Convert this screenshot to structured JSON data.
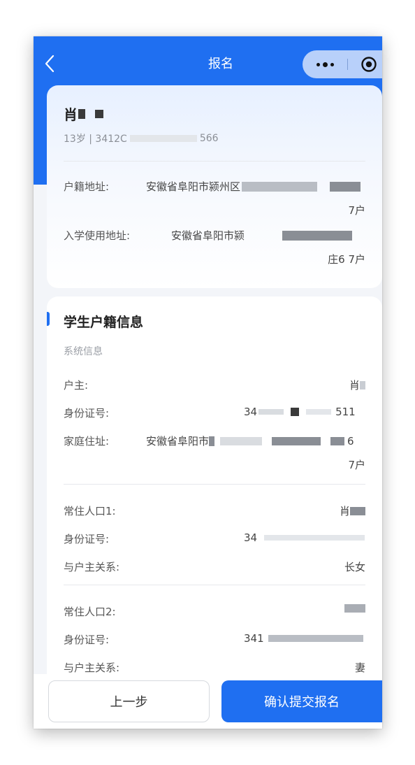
{
  "nav": {
    "title": "报名"
  },
  "student": {
    "name": "肖",
    "age_id_prefix": "13岁 | 3412C",
    "age_id_suffix": "566"
  },
  "address": {
    "household_label": "户籍地址:",
    "household_value": "安徽省阜阳市颍州区",
    "household_tail": "7户",
    "school_label": "入学使用地址:",
    "school_value": "安徽省阜阳市颍",
    "school_tail": "庄6 7户"
  },
  "household_info": {
    "title": "学生户籍信息",
    "subtitle": "系统信息",
    "head_label": "户主:",
    "head_value": "肖",
    "id_label": "身份证号:",
    "id_prefix": "34",
    "id_suffix": "511",
    "home_label": "家庭住址:",
    "home_value": "安徽省阜阳市",
    "home_end": "6",
    "home_tail": "7户"
  },
  "residents": [
    {
      "label": "常住人口1:",
      "name": "肖",
      "id_label": "身份证号:",
      "id_prefix": "34",
      "rel_label": "与户主关系:",
      "relation": "长女"
    },
    {
      "label": "常住人口2:",
      "name": "",
      "id_label": "身份证号:",
      "id_prefix": "341",
      "rel_label": "与户主关系:",
      "relation": "妻"
    }
  ],
  "buttons": {
    "prev": "上一步",
    "submit": "确认提交报名"
  }
}
